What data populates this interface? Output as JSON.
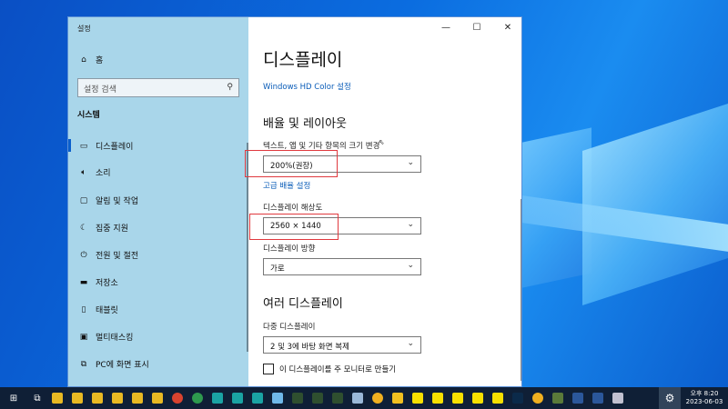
{
  "window": {
    "title": "설정",
    "minimize_icon": "minimize-icon",
    "maximize_icon": "maximize-icon",
    "close_icon": "close-icon"
  },
  "sidebar": {
    "home_label": "홈",
    "search_placeholder": "설정 검색",
    "section_label": "시스템",
    "items": [
      {
        "label": "디스플레이",
        "icon": "monitor-icon",
        "selected": true
      },
      {
        "label": "소리",
        "icon": "speaker-icon"
      },
      {
        "label": "알림 및 작업",
        "icon": "notification-icon"
      },
      {
        "label": "집중 지원",
        "icon": "moon-icon"
      },
      {
        "label": "전원 및 절전",
        "icon": "power-icon"
      },
      {
        "label": "저장소",
        "icon": "storage-icon"
      },
      {
        "label": "태블릿",
        "icon": "tablet-icon"
      },
      {
        "label": "멀티태스킹",
        "icon": "multitask-icon"
      },
      {
        "label": "PC에 화면 표시",
        "icon": "project-icon"
      }
    ]
  },
  "main": {
    "page_title": "디스플레이",
    "hd_color_link": "Windows HD Color 설정",
    "scale_section_title": "배율 및 레이아웃",
    "scale_label": "텍스트, 앱 및 기타 항목의 크기 변경",
    "scale_value": "200%(권장)",
    "advanced_scale_link": "고급 배율 설정",
    "resolution_label": "디스플레이 해상도",
    "resolution_value": "2560 × 1440",
    "orientation_label": "디스플레이 방향",
    "orientation_value": "가로",
    "multi_display_title": "여러 디스플레이",
    "multi_display_label": "다중 디스플레이",
    "multi_display_value": "2 및 3에 바탕 화면 복제",
    "primary_checkbox_label": "이 디스플레이를 주 모니터로 만들기",
    "primary_checked": false
  },
  "taskbar": {
    "clock_time": "오후 8:20",
    "clock_date": "2023-06-03",
    "accent": "#0f1f36",
    "highlight_color": "#e0393e"
  }
}
